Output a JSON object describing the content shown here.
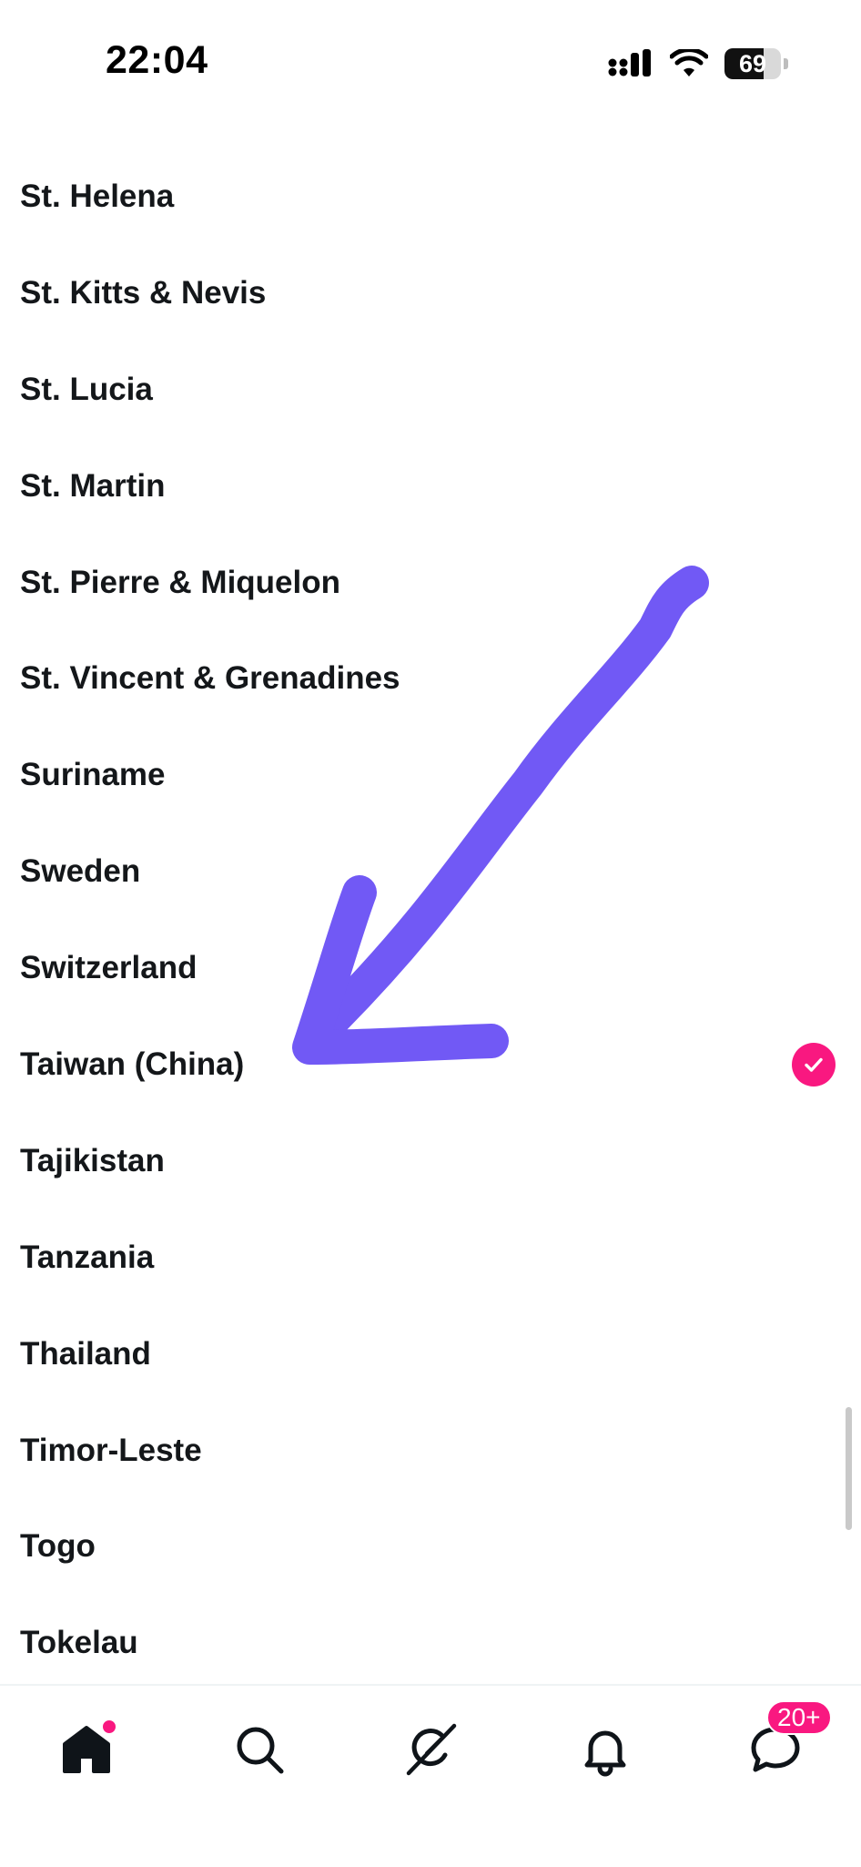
{
  "status_bar": {
    "time": "22:04",
    "battery": "69",
    "battery_level": 0.69,
    "icons": [
      "cellular-signal-icon",
      "wifi-icon",
      "battery-icon"
    ]
  },
  "countries": [
    {
      "label": "St. Helena",
      "selected": false
    },
    {
      "label": "St. Kitts & Nevis",
      "selected": false
    },
    {
      "label": "St. Lucia",
      "selected": false
    },
    {
      "label": "St. Martin",
      "selected": false
    },
    {
      "label": "St. Pierre & Miquelon",
      "selected": false
    },
    {
      "label": "St. Vincent & Grenadines",
      "selected": false
    },
    {
      "label": "Suriname",
      "selected": false
    },
    {
      "label": "Sweden",
      "selected": false
    },
    {
      "label": "Switzerland",
      "selected": false
    },
    {
      "label": "Taiwan (China)",
      "selected": true
    },
    {
      "label": "Tajikistan",
      "selected": false
    },
    {
      "label": "Tanzania",
      "selected": false
    },
    {
      "label": "Thailand",
      "selected": false
    },
    {
      "label": "Timor-Leste",
      "selected": false
    },
    {
      "label": "Togo",
      "selected": false
    },
    {
      "label": "Tokelau",
      "selected": false
    }
  ],
  "tab_bar": {
    "tabs": [
      "home-icon",
      "search-icon",
      "grok-icon",
      "notifications-icon",
      "messages-icon"
    ],
    "messages_badge": "20+"
  },
  "colors": {
    "accent": "#f91880",
    "annotation": "#7159f5",
    "text": "#14171a"
  }
}
